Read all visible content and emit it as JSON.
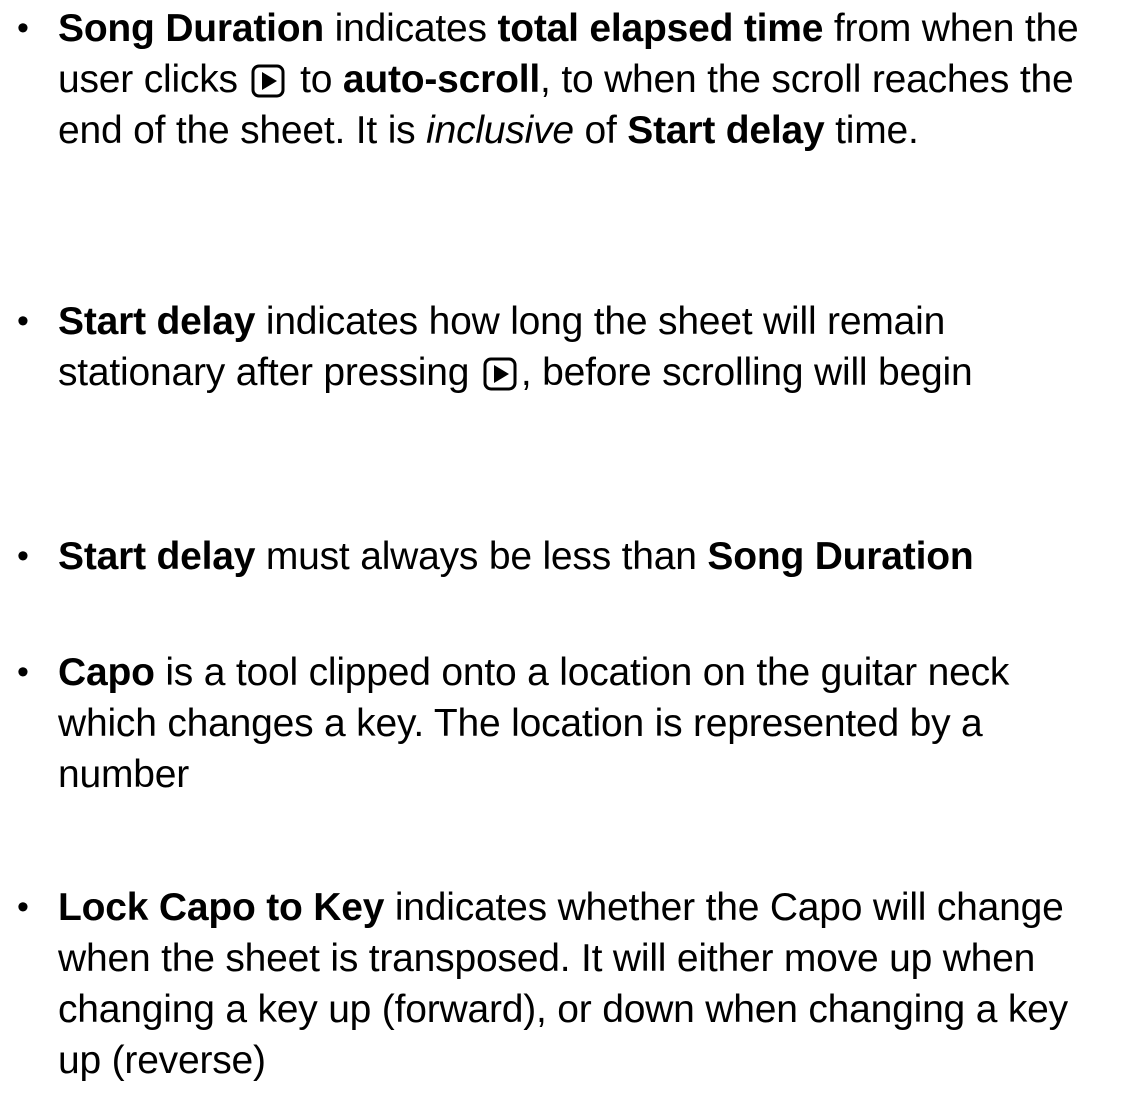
{
  "bullet_glyph": "•",
  "icon": "play-button-icon",
  "items": [
    {
      "term": "Song Duration",
      "t1": " indicates ",
      "b1": "total elapsed time",
      "t2": "  from when the user clicks ",
      "t3": " to ",
      "b2": "auto-scroll",
      "t4": ", to when the scroll reaches the end of the sheet. It is ",
      "i1": "inclusive",
      "t5": " of ",
      "b3": "Start delay",
      "t6": " time."
    },
    {
      "term": "Start delay",
      "t1": " indicates how long the sheet will remain stationary after pressing ",
      "t2": ", before scrolling will begin"
    },
    {
      "term": "Start delay",
      "t1": " must always be less than ",
      "b1": "Song Duration"
    },
    {
      "term": "Capo",
      "t1": " is a tool clipped onto a location on the guitar neck which changes a key. The location is represented by a number"
    },
    {
      "term": "Lock Capo to Key",
      "t1": " indicates whether the Capo will change when the sheet is transposed. It will either move up when changing a key up (forward), or down when changing a key up (reverse)"
    }
  ]
}
